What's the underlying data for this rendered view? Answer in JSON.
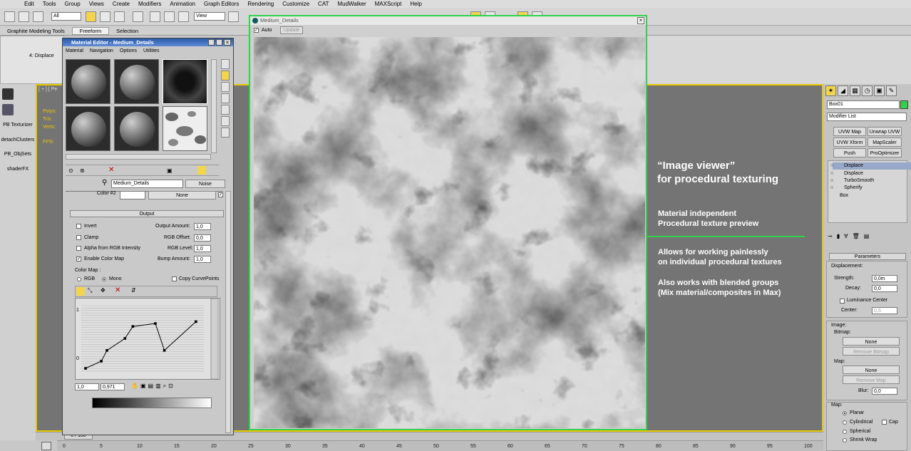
{
  "menubar": [
    "Edit",
    "Tools",
    "Group",
    "Views",
    "Create",
    "Modifiers",
    "Animation",
    "Graph Editors",
    "Rendering",
    "Customize",
    "CAT",
    "MudWalker",
    "MAXScript",
    "Help"
  ],
  "toolbar": {
    "filter_value": "All",
    "view_value": "View"
  },
  "ribbon": {
    "tabs": [
      "Graphite Modeling Tools",
      "Freeform",
      "Selection"
    ],
    "active": "Freeform",
    "panel_label": "4: Displace"
  },
  "leftbar": {
    "items": [
      "PB Texturizer",
      "detachClusters",
      "PB_ObjSets",
      "shaderFX"
    ]
  },
  "viewport": {
    "label": "[ + ] [ Pe",
    "stats": [
      "Polys:",
      "Tris:",
      "Verts:",
      "FPS:"
    ]
  },
  "material_editor": {
    "title": "Material Editor - Medium_Details",
    "menu": [
      "Material",
      "Navigation",
      "Options",
      "Utilities"
    ],
    "map_name": "Medium_Details",
    "map_type": "Noise",
    "color2_label": "Color #2",
    "color2_map": "None",
    "output_header": "Output",
    "checkboxes": [
      {
        "label": "Invert",
        "checked": false
      },
      {
        "label": "Clamp",
        "checked": false
      },
      {
        "label": "Alpha from RGB Intensity",
        "checked": false
      },
      {
        "label": "Enable Color Map",
        "checked": true
      }
    ],
    "spinners": [
      {
        "label": "Output Amount:",
        "value": "1,0"
      },
      {
        "label": "RGB Offset:",
        "value": "0,0"
      },
      {
        "label": "RGB Level:",
        "value": "1,0"
      },
      {
        "label": "Bump Amount:",
        "value": "1,0"
      }
    ],
    "color_map": {
      "label": "Color Map :",
      "rgb": "RGB",
      "mono": "Mono",
      "copy": "Copy CurvePoints",
      "mode": "Mono"
    },
    "curve": {
      "y_top": "1",
      "y_bottom": "0",
      "x_field": "1,0",
      "y_field": "0,971",
      "points": [
        [
          0.0,
          0.0
        ],
        [
          0.14,
          0.12
        ],
        [
          0.19,
          0.3
        ],
        [
          0.35,
          0.5
        ],
        [
          0.42,
          0.7
        ],
        [
          0.62,
          0.75
        ],
        [
          0.7,
          0.3
        ],
        [
          0.98,
          0.78
        ]
      ]
    }
  },
  "viewer": {
    "title": "Medium_Details",
    "auto": "Auto",
    "update": "Update"
  },
  "overlay": {
    "heading": [
      "“Image viewer”",
      "for procedural texturing"
    ],
    "block1": [
      "Material independent",
      "Procedural texture preview"
    ],
    "block2": [
      "Allows for working painlessly",
      "on individual procedural textures"
    ],
    "block3": [
      "Also works with blended groups",
      "(Mix material/composites in Max)"
    ]
  },
  "command_panel": {
    "object_name": "Box01",
    "modifier_list": "Modifier List",
    "buttons": [
      "UVW Map",
      "Unwrap UVW",
      "UVW Xform",
      "MapScaler",
      "Push",
      "ProOptimizer"
    ],
    "stack": [
      {
        "label": "Displace",
        "selected": true
      },
      {
        "label": "Displace",
        "selected": false
      },
      {
        "label": "TurboSmooth",
        "selected": false
      },
      {
        "label": "Spherify",
        "selected": false
      },
      {
        "label": "Box",
        "selected": false
      }
    ],
    "params_header": "Parameters",
    "displacement_label": "Displacement:",
    "strength": {
      "label": "Strength:",
      "value": "0,0m"
    },
    "decay": {
      "label": "Decay:",
      "value": "0,0"
    },
    "luminance": "Luminance Center",
    "center": {
      "label": "Center:",
      "value": "0,5"
    },
    "image_label": "Image:",
    "bitmap_label": "Bitmap:",
    "bitmap_btn": "None",
    "remove_bitmap": "Remove Bitmap",
    "map_label": "Map:",
    "map_btn": "None",
    "remove_map": "Remove Map",
    "blur": {
      "label": "Blur:",
      "value": "0,0"
    },
    "map_section": "Map:",
    "map_types": [
      "Planar",
      "Cylindrical",
      "Spherical",
      "Shrink Wrap"
    ],
    "cap": "Cap",
    "accent": "#2fd24a"
  },
  "timeline": {
    "frame": "0 / 100",
    "ticks": [
      "0",
      "5",
      "10",
      "15",
      "20",
      "25",
      "30",
      "35",
      "40",
      "45",
      "50",
      "55",
      "60",
      "65",
      "70",
      "75",
      "80",
      "85",
      "90",
      "95",
      "100"
    ]
  }
}
